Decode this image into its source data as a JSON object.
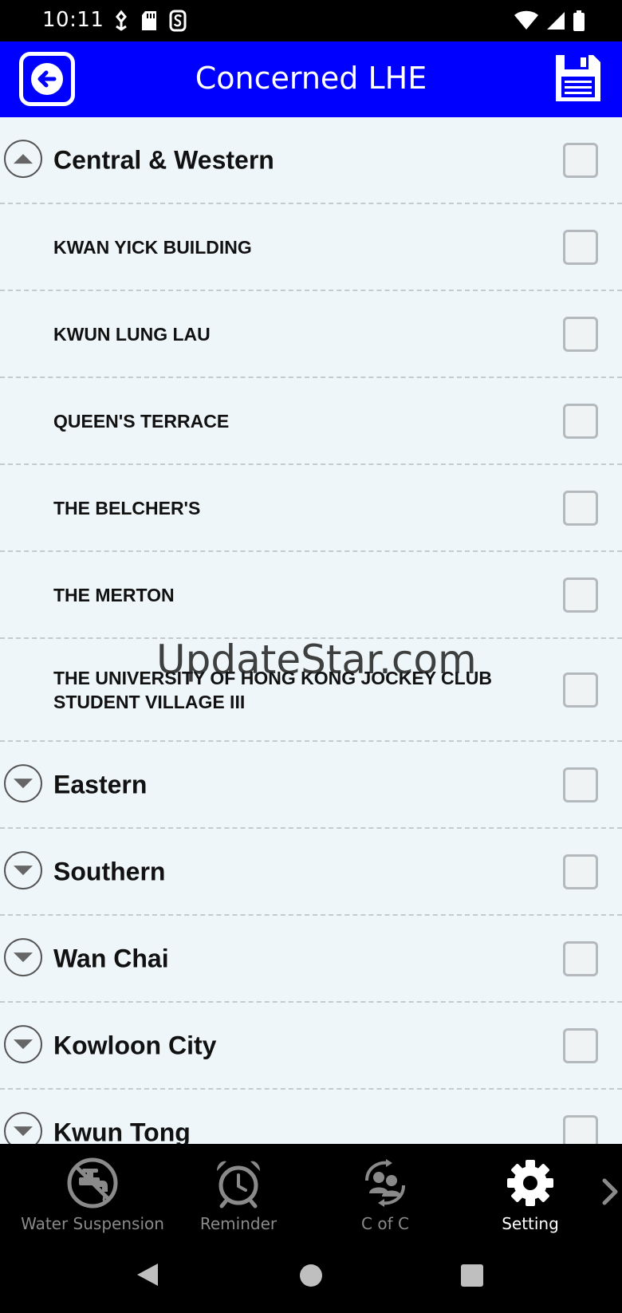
{
  "status_bar": {
    "time": "10:11"
  },
  "app_bar": {
    "title": "Concerned LHE",
    "back_icon": "back-arrow-icon",
    "save_icon": "floppy-disk-icon"
  },
  "list": {
    "groups_top": {
      "label": "Central & Western",
      "expanded": true,
      "checked": false
    },
    "children": [
      {
        "label": "KWAN YICK BUILDING",
        "checked": false
      },
      {
        "label": "KWUN LUNG LAU",
        "checked": false
      },
      {
        "label": "QUEEN'S TERRACE",
        "checked": false
      },
      {
        "label": "THE BELCHER'S",
        "checked": false
      },
      {
        "label": "THE MERTON",
        "checked": false
      },
      {
        "label": "THE UNIVERSITY OF HONG KONG JOCKEY CLUB STUDENT VILLAGE III",
        "checked": false
      }
    ],
    "groups": [
      {
        "label": "Eastern",
        "expanded": false,
        "checked": false
      },
      {
        "label": "Southern",
        "expanded": false,
        "checked": false
      },
      {
        "label": "Wan Chai",
        "expanded": false,
        "checked": false
      },
      {
        "label": "Kowloon City",
        "expanded": false,
        "checked": false
      },
      {
        "label": "Kwun Tong",
        "expanded": false,
        "checked": false
      }
    ]
  },
  "watermark": "UpdateStar.com",
  "bottom_nav": {
    "items": [
      {
        "label": "Water Suspension",
        "icon": "water-tap-off-icon",
        "active": false
      },
      {
        "label": "Reminder",
        "icon": "alarm-clock-icon",
        "active": false
      },
      {
        "label": "C of C",
        "icon": "people-cycle-icon",
        "active": false
      },
      {
        "label": "Setting",
        "icon": "gear-icon",
        "active": true
      }
    ],
    "more_icon": "chevron-right-icon"
  },
  "colors": {
    "app_bar": "#0000ff",
    "list_background": "#eef6f9",
    "active_nav": "#ffffff",
    "inactive_nav": "#8a8a8a"
  }
}
